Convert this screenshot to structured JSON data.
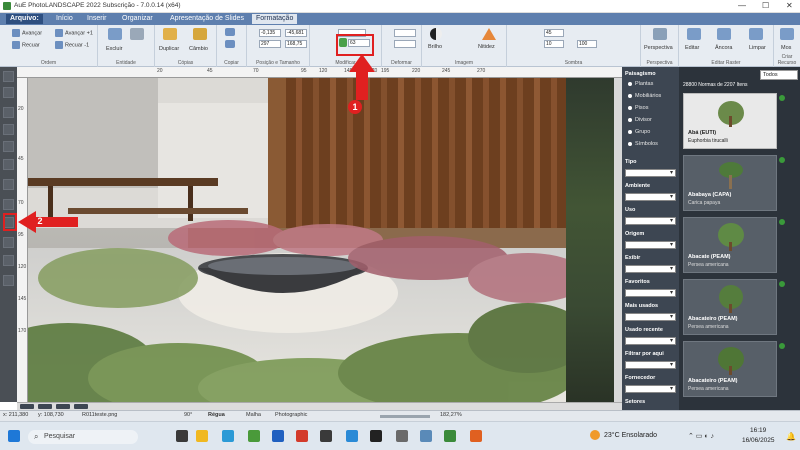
{
  "window": {
    "title": "AuE PhotoLANDSCAPE 2022 Subscrição - 7.0.0.14 (x64)"
  },
  "menu": [
    "Arquivo:",
    "Início",
    "Inserir",
    "Organizar",
    "Apresentação de Slides",
    "Formatação"
  ],
  "ribbon": {
    "ordem": {
      "label": "Ordem",
      "avancar": "Avançar",
      "avancar1": "Avançar +1",
      "recuar": "Recuar",
      "recuar1": "Recuar -1"
    },
    "entidade": {
      "label": "Entidade",
      "excluir": "Excluir"
    },
    "copias": {
      "label": "Cópias",
      "duplicar": "Duplicar",
      "cambio": "Câmbio"
    },
    "copiar": {
      "label": "Copiar"
    },
    "posicao": {
      "label": "Posição e Tamanho",
      "x": "-0,135",
      "y": "-45,681",
      "w": "297",
      "h": "168,75"
    },
    "modificar": {
      "label": "Modificar",
      "value": "63"
    },
    "deformar": {
      "label": "Deformar"
    },
    "imagem": {
      "label": "Imagem",
      "brilho": "Brilho",
      "nitidez": "Nitidez"
    },
    "sombra": {
      "label": "Sombra",
      "v1": "45",
      "v2": "10",
      "v3": "100"
    },
    "perspectiva": {
      "label": "Perspectiva",
      "btn": "Perspectiva"
    },
    "editar_raster": {
      "label": "Editar Raster",
      "editar": "Editar",
      "ancora": "Âncora",
      "limpar": "Limpar"
    },
    "criar_recurso": {
      "label": "Criar Recurso",
      "mos": "Mos"
    }
  },
  "rulers": {
    "top": [
      "20",
      "45",
      "70",
      "95",
      "120",
      "145",
      "170",
      "195",
      "220",
      "245",
      "270"
    ],
    "left": [
      "20",
      "45",
      "70",
      "95",
      "120",
      "145",
      "170"
    ]
  },
  "library": {
    "heading": "Paisagismo",
    "radios": [
      "Plantas",
      "Mobiliários",
      "Pisos",
      "Divisor",
      "Grupo",
      "Símbolos"
    ],
    "filters": [
      "Tipo",
      "Ambiente",
      "Uso",
      "Origem",
      "Exibir",
      "Favoritos",
      "Mais usados",
      "Usado recente",
      "Filtrar por aqui",
      "Fornecedor",
      "Setores"
    ],
    "dropdown": "Todos",
    "count": "28800 Normas de 2207 Itens",
    "items": [
      {
        "name": "Abá (EUTI)",
        "sci": "Euphorbia tirucalli"
      },
      {
        "name": "Ababaya (CAPA)",
        "sci": "Carica papaya"
      },
      {
        "name": "Abacate (PEAM)",
        "sci": "Persea americana"
      },
      {
        "name": "Abacateiro (PEAM)",
        "sci": "Persea americana"
      },
      {
        "name": "Abacateiro (PEAM)",
        "sci": "Persea americana"
      }
    ]
  },
  "status": {
    "x": "x: 211,380",
    "y": "y: 108,730",
    "file": "R011teste.png",
    "angle": "90°",
    "regua": "Régua",
    "malha": "Malha",
    "mode": "Photographic",
    "zoom": "182,27%"
  },
  "taskbar": {
    "search": "Pesquisar",
    "weather": "23°C Ensolarado",
    "time": "16:19",
    "date": "16/06/2025"
  },
  "callouts": [
    "1",
    "2"
  ],
  "colors": {
    "menubar": "#5e7fae",
    "accent": "#e02020",
    "panel": "#3d4652"
  }
}
